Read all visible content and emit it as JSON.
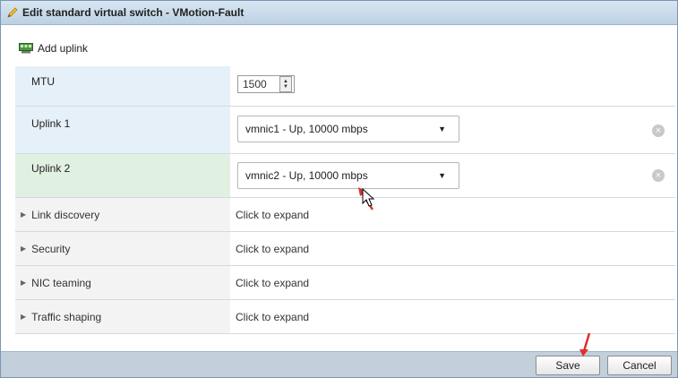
{
  "dialog": {
    "title": "Edit standard virtual switch - VMotion-Fault"
  },
  "toolbar": {
    "add_uplink_label": "Add uplink"
  },
  "settings": {
    "mtu": {
      "label": "MTU",
      "value": "1500"
    },
    "uplinks": [
      {
        "label": "Uplink 1",
        "value": "vmnic1 - Up, 10000 mbps"
      },
      {
        "label": "Uplink 2",
        "value": "vmnic2 - Up, 10000 mbps"
      }
    ],
    "sections": [
      {
        "label": "Link discovery",
        "value": "Click to expand"
      },
      {
        "label": "Security",
        "value": "Click to expand"
      },
      {
        "label": "NIC teaming",
        "value": "Click to expand"
      },
      {
        "label": "Traffic shaping",
        "value": "Click to expand"
      }
    ]
  },
  "footer": {
    "save_label": "Save",
    "cancel_label": "Cancel"
  },
  "colors": {
    "title_bar": "#bcd0e4",
    "footer": "#c3cfdb",
    "annotation_arrow": "#e0302a"
  }
}
